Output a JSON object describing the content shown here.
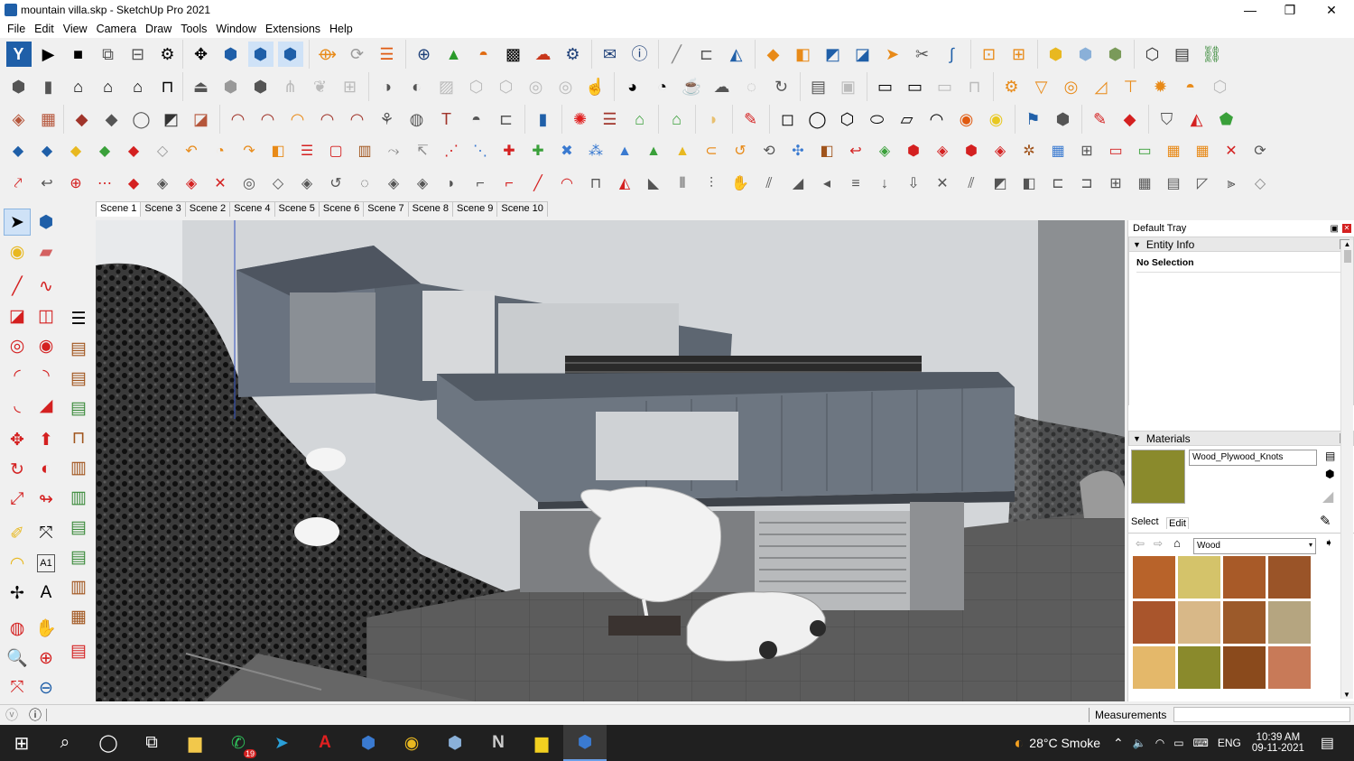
{
  "window": {
    "title": "mountain villa.skp - SketchUp Pro 2021",
    "controls": [
      "—",
      "❐",
      "✕"
    ]
  },
  "menu": [
    "File",
    "Edit",
    "View",
    "Camera",
    "Draw",
    "Tools",
    "Window",
    "Extensions",
    "Help"
  ],
  "toolbars": {
    "row1": [
      "sketchup-logo-icon",
      "play-icon",
      "stop-icon",
      "component-options-icon",
      "component-attributes-icon",
      "settings-icon",
      "orbit-icon",
      "pan-icon",
      "zoom-icon",
      "walk-icon",
      "select-icon",
      "refresh-icon",
      "move-icon",
      "add-icon",
      "tree-icon",
      "sun-icon",
      "checker-icon",
      "cloud-icon",
      "gear-icon",
      "mail-icon",
      "info-icon",
      "pencil-icon",
      "dimension-icon",
      "eye-icon",
      "eraser-icon",
      "box-icon",
      "box-open-icon",
      "arrow-icon",
      "follow-icon",
      "scissors-icon",
      "curve-icon",
      "scale-icon",
      "dimension2-icon",
      "cube-icon",
      "cube-light-icon",
      "cube-dark-icon",
      "component-icon",
      "report-icon",
      "link-icon"
    ],
    "row2_count": 40,
    "row3_count": 36,
    "row4_count": 44,
    "row5_count": 44
  },
  "scenes": [
    "Scene 1",
    "Scene 3",
    "Scene 2",
    "Scene 4",
    "Scene 5",
    "Scene 6",
    "Scene 7",
    "Scene 8",
    "Scene 9",
    "Scene 10"
  ],
  "active_scene": "Scene 1",
  "tray": {
    "title": "Default Tray",
    "entity_info": {
      "label": "Entity Info",
      "selection": "No Selection"
    },
    "materials": {
      "label": "Materials",
      "material_name": "Wood_Plywood_Knots",
      "select_tab": "Select",
      "edit_tab": "Edit",
      "library": "Wood",
      "swatch_colors": [
        "#b8632a",
        "#d4c36a",
        "#a85a28",
        "#9a5428",
        "#a9552c",
        "#d8b888",
        "#9c5a2a",
        "#b5a580",
        "#e4b86a",
        "#8a8a2c",
        "#8a4a1c",
        "#c87a58"
      ]
    }
  },
  "status": {
    "measurements_label": "Measurements"
  },
  "taskbar": {
    "weather": "28°C Smoke",
    "language": "ENG",
    "time": "10:39 AM",
    "date": "09-11-2021",
    "whatsapp_badge": "19"
  },
  "colors": {
    "accent_blue": "#1f5fa8",
    "icon_red": "#d42020",
    "icon_orange": "#e88a18",
    "icon_green": "#3aa03a",
    "taskbar": "#202020"
  }
}
